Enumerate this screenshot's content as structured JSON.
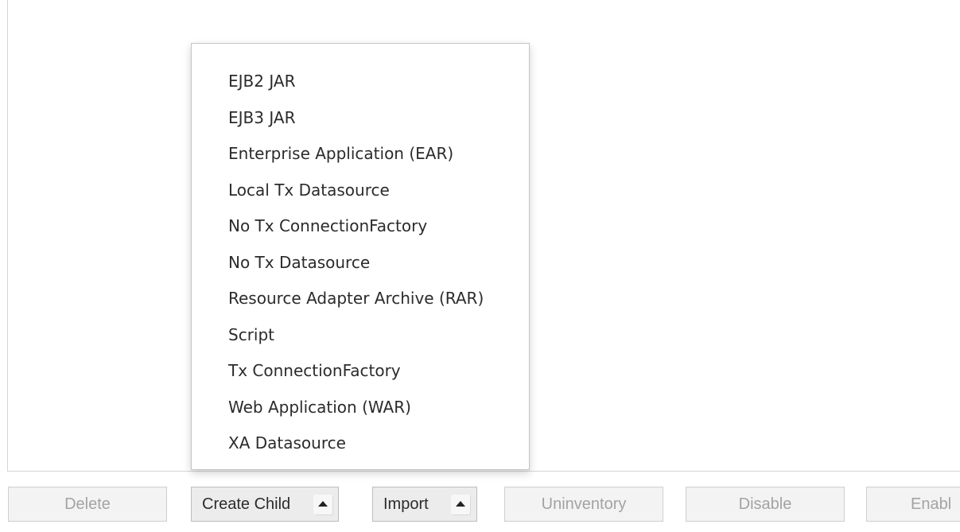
{
  "dropdown": {
    "items": [
      "EJB2 JAR",
      "EJB3 JAR",
      "Enterprise Application (EAR)",
      "Local Tx Datasource",
      "No Tx ConnectionFactory",
      "No Tx Datasource",
      "Resource Adapter Archive (RAR)",
      "Script",
      "Tx ConnectionFactory",
      "Web Application (WAR)",
      "XA Datasource"
    ]
  },
  "toolbar": {
    "delete_label": "Delete",
    "create_child_label": "Create Child",
    "create_child_icon": "caret-up-icon",
    "import_label": "Import",
    "import_icon": "caret-up-icon",
    "uninventory_label": "Uninventory",
    "disable_label": "Disable",
    "enable_label": "Enabl"
  }
}
